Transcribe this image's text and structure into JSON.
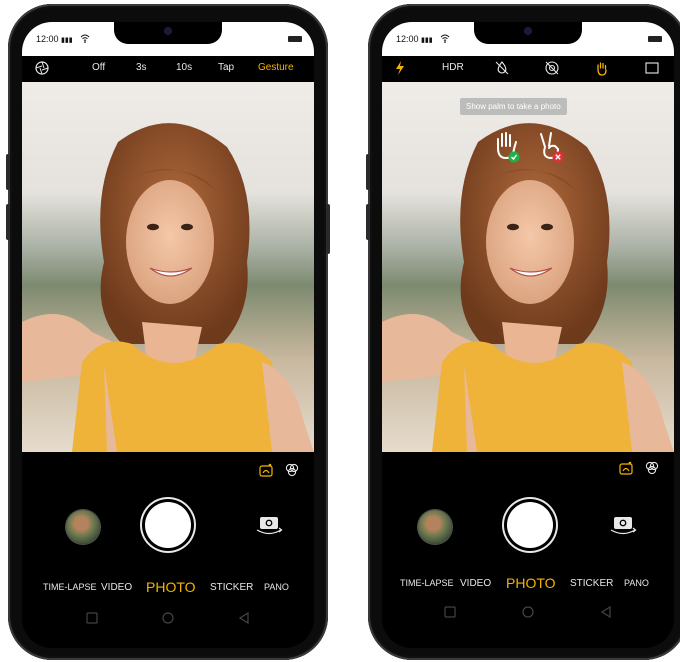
{
  "status": {
    "time": "12:00",
    "signal": "▮▮▮",
    "wifi": "wifi-icon"
  },
  "left_phone": {
    "topbar": {
      "icon": "aperture-icon",
      "options": [
        "Off",
        "3s",
        "10s",
        "Tap",
        "Gesture"
      ],
      "active": "Gesture"
    },
    "modes": [
      "TIME-LAPSE",
      "VIDEO",
      "PHOTO",
      "STICKER",
      "PANO"
    ],
    "active_mode": "PHOTO"
  },
  "right_phone": {
    "topbar": {
      "icons": [
        "flash-icon",
        "hdr-icon",
        "beauty-drop-icon",
        "filter-off-icon",
        "palm-gesture-icon",
        "aspect-ratio-icon"
      ],
      "hdr_label": "HDR"
    },
    "toast": "Show palm to take a photo",
    "modes": [
      "TIME-LAPSE",
      "VIDEO",
      "PHOTO",
      "STICKER",
      "PANO"
    ],
    "active_mode": "PHOTO"
  },
  "colors": {
    "accent": "#f5b300",
    "bar": "#000000",
    "text": "#e8e8e8",
    "ok": "#1fb04a",
    "bad": "#e0303a"
  }
}
